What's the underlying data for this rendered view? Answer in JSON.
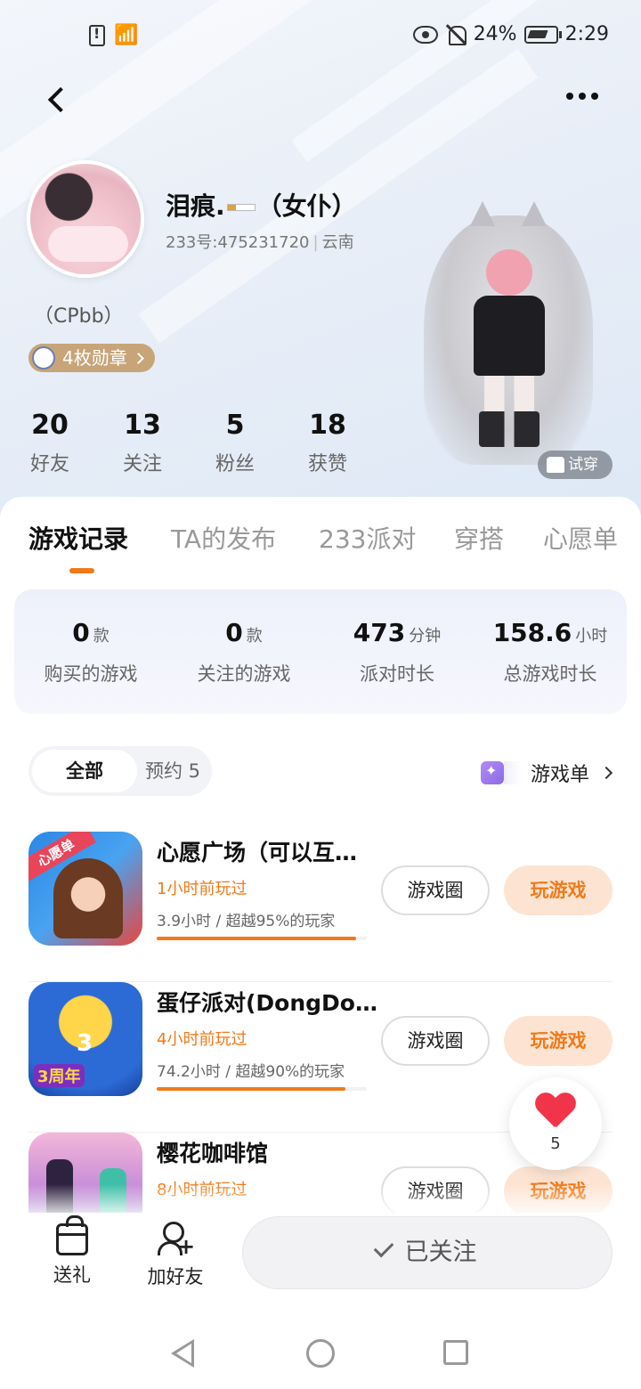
{
  "status_bar": {
    "battery": "24%",
    "time": "2:29"
  },
  "profile": {
    "name_prefix": "泪痕.",
    "name_suffix": "（女仆）",
    "id_text": "233号:475231720",
    "region": "云南",
    "bio": "（CPbb）",
    "medals": "4枚勋章"
  },
  "stats": [
    {
      "num": "20",
      "label": "好友"
    },
    {
      "num": "13",
      "label": "关注"
    },
    {
      "num": "5",
      "label": "粉丝"
    },
    {
      "num": "18",
      "label": "获赞"
    }
  ],
  "try_on": "试穿",
  "tabs": [
    {
      "label": "游戏记录"
    },
    {
      "label": "TA的发布"
    },
    {
      "label": "233派对"
    },
    {
      "label": "穿搭"
    },
    {
      "label": "心愿单"
    }
  ],
  "summary": [
    {
      "value": "0",
      "unit": "款",
      "label": "购买的游戏"
    },
    {
      "value": "0",
      "unit": "款",
      "label": "关注的游戏"
    },
    {
      "value": "473",
      "unit": "分钟",
      "label": "派对时长"
    },
    {
      "value": "158.6",
      "unit": "小时",
      "label": "总游戏时长"
    }
  ],
  "filter": {
    "all": "全部",
    "reserve": "预约 5"
  },
  "game_list_link": "游戏单",
  "games": [
    {
      "title": "心愿广场（可以互…",
      "last_played": "1小时前玩过",
      "stat": "3.9小时 / 超越95%的玩家",
      "progress": 0.95,
      "icon_text": "心愿单",
      "circle": "游戏圈",
      "play": "玩游戏"
    },
    {
      "title": "蛋仔派对(DongDo…",
      "last_played": "4小时前玩过",
      "stat": "74.2小时 / 超越90%的玩家",
      "progress": 0.9,
      "icon_text": "3周年",
      "circle": "游戏圈",
      "play": "玩游戏"
    },
    {
      "title": "樱花咖啡馆",
      "last_played": "8小时前玩过",
      "stat": "",
      "progress": 0,
      "icon_text": "",
      "circle": "游戏圈",
      "play": "玩游戏"
    }
  ],
  "likes": "5",
  "actions": {
    "gift": "送礼",
    "add_friend": "加好友",
    "followed": "已关注"
  }
}
